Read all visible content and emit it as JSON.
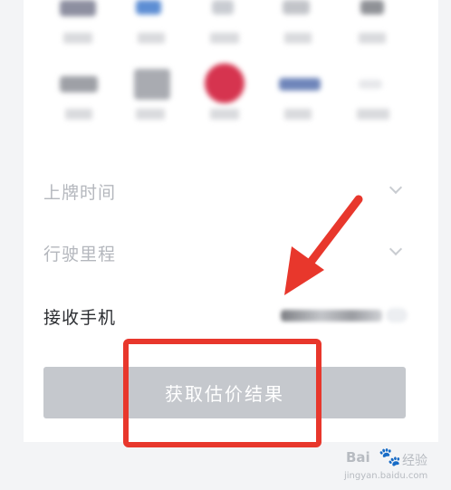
{
  "form": {
    "plate_time_label": "上牌时间",
    "mileage_label": "行驶里程",
    "phone_label": "接收手机",
    "submit_label": "获取估价结果"
  },
  "watermark": {
    "brand": "Bai",
    "brand_suffix": "经验",
    "url": "jingyan.baidu.com"
  },
  "colors": {
    "highlight": "#e8372c",
    "button_disabled": "#c5c8cd"
  },
  "icons": {
    "chevron": "chevron-down-icon",
    "arrow": "red-arrow-annotation"
  }
}
